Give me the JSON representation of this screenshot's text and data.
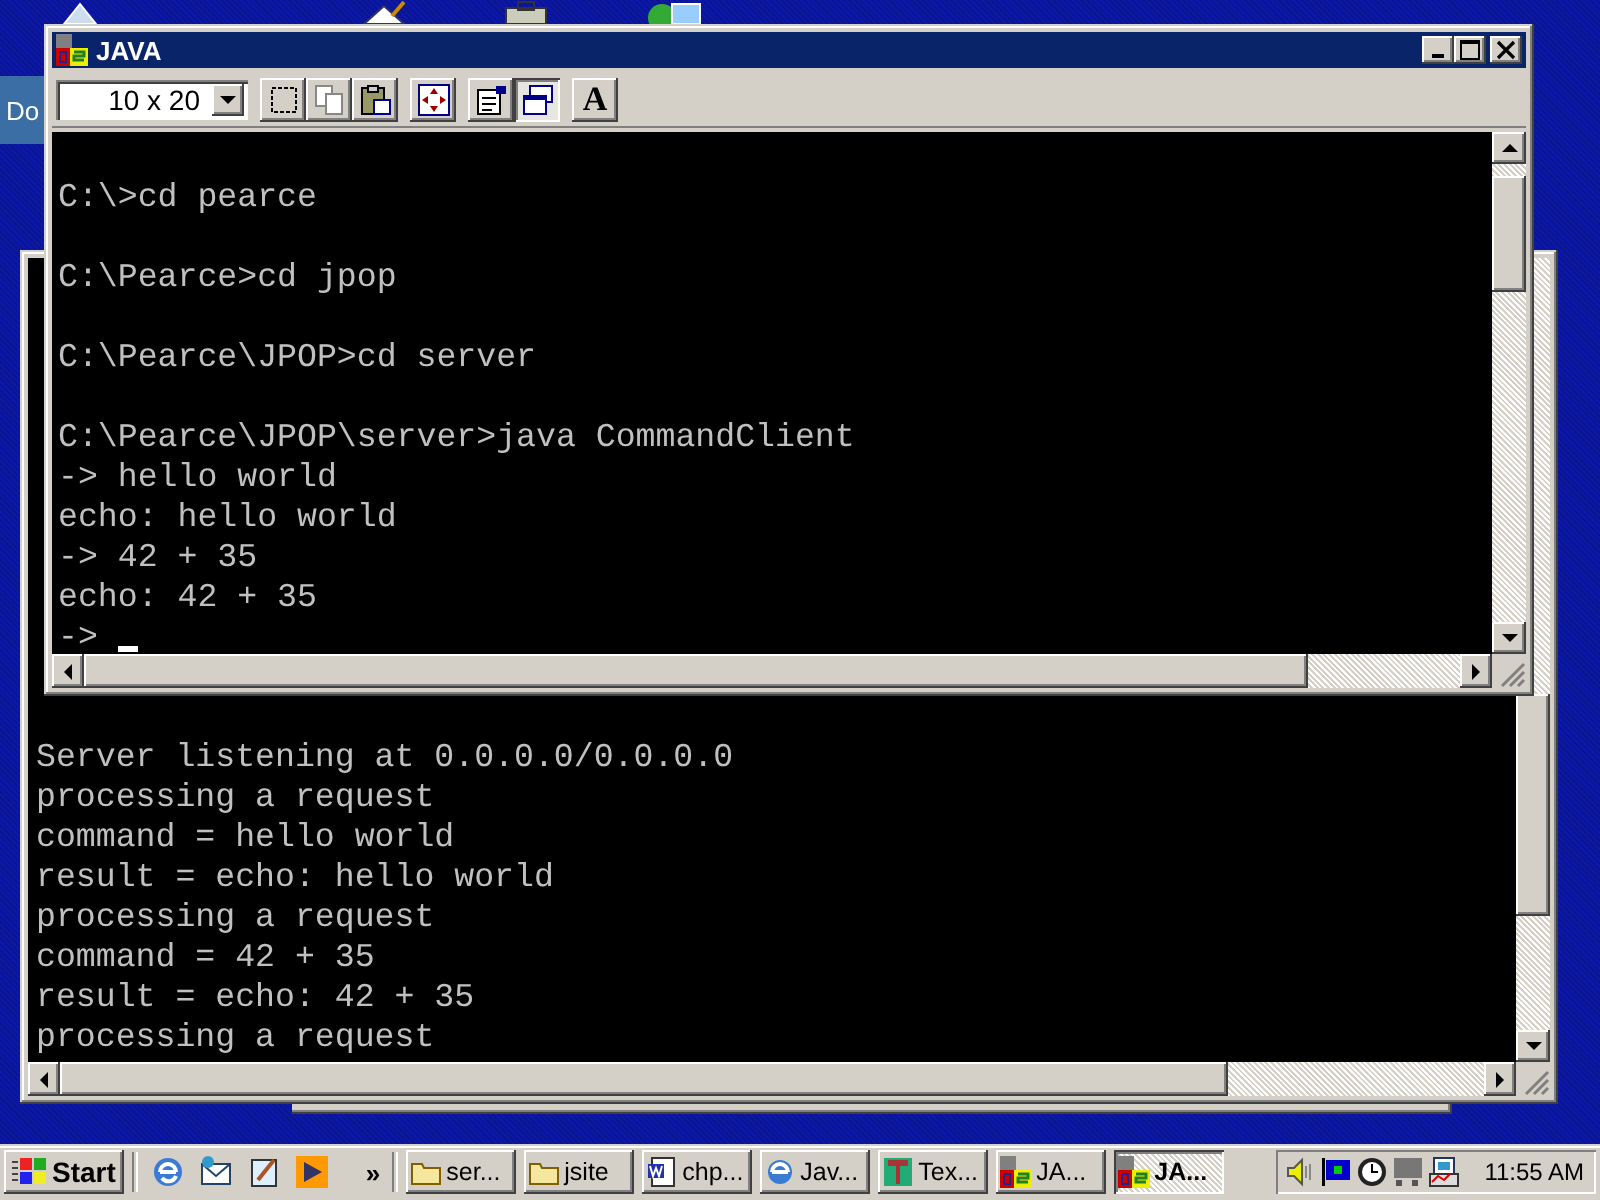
{
  "desktop": {
    "icon_label": "Do"
  },
  "front_window": {
    "title": "JAVA",
    "toolbar": {
      "font_size": "10 x 20",
      "buttons": [
        {
          "kind": "mark",
          "pressed": false
        },
        {
          "kind": "copy",
          "pressed": false
        },
        {
          "kind": "paste",
          "pressed": false
        },
        {
          "kind": "fullscreen",
          "pressed": false
        },
        {
          "kind": "properties",
          "pressed": false
        },
        {
          "kind": "background",
          "pressed": true
        },
        {
          "kind": "font",
          "pressed": false,
          "label": "A"
        }
      ]
    },
    "blocks": [
      [
        "C:\\>cd pearce"
      ],
      [
        "C:\\Pearce>cd jpop"
      ],
      [
        "C:\\Pearce\\JPOP>cd server"
      ],
      [
        "C:\\Pearce\\JPOP\\server>java CommandClient",
        "-> hello world",
        "echo: hello world",
        "-> 42 + 35",
        "echo: 42 + 35",
        "->"
      ]
    ],
    "cursor": true
  },
  "back_window": {
    "lines": [
      "Server listening at 0.0.0.0/0.0.0.0",
      "processing a request",
      "command = hello world",
      "result = echo: hello world",
      "processing a request",
      "command = 42 + 35",
      "result = echo: 42 + 35",
      "processing a request"
    ]
  },
  "taskbar": {
    "start": "Start",
    "quick_launch": [
      {
        "kind": "browser"
      },
      {
        "kind": "mail"
      },
      {
        "kind": "notepad"
      },
      {
        "kind": "media"
      }
    ],
    "more": "»",
    "tasks": [
      {
        "label": "ser...",
        "kind": "folder",
        "selected": false
      },
      {
        "label": "jsite",
        "kind": "folder",
        "selected": false
      },
      {
        "label": "chp...",
        "kind": "document",
        "selected": false
      },
      {
        "label": "Jav...",
        "kind": "browser",
        "selected": false
      },
      {
        "label": "Tex...",
        "kind": "editor",
        "selected": false
      },
      {
        "label": "JA...",
        "kind": "dos",
        "selected": false
      },
      {
        "label": "JA...",
        "kind": "dos",
        "selected": true
      }
    ],
    "tray": [
      {
        "kind": "volume"
      },
      {
        "kind": "flag"
      },
      {
        "kind": "clock"
      },
      {
        "kind": "monitor"
      },
      {
        "kind": "network"
      }
    ],
    "clock": "11:55 AM"
  }
}
